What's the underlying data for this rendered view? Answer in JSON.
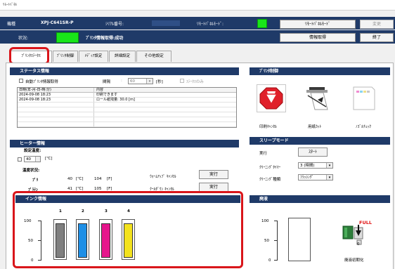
{
  "window": {
    "title": "ﾘﾓｰﾄﾊﾟﾈﾙ"
  },
  "header": {
    "model_label": "機種",
    "model_value": "XPJ-C641SR-P",
    "serial_label": "ｼﾘｱﾙ番号:",
    "serial_value": "",
    "remote_mode_label": "ﾘﾓｰﾄﾊﾟﾈﾙﾓｰﾄﾞ:",
    "remote_panel_mode_button": "ﾘﾓｰﾄﾊﾟﾈﾙﾓｰﾄﾞ",
    "change_button": "変更",
    "status_label": "状況:",
    "status_message": "ﾌﾟﾘﾝﾀ情報取得:成功",
    "info_get_button": "情報取得",
    "exit_button": "終了",
    "status_color": "#19e619"
  },
  "tabs": [
    {
      "label": "ﾌﾟﾘﾝﾀｽﾃｰﾀｽ",
      "active": true
    },
    {
      "label": "ﾌﾟﾘﾝﾀ制御",
      "active": false
    },
    {
      "label": "ﾒﾃﾞｨｱ設定",
      "active": false
    },
    {
      "label": "詳細設定",
      "active": false
    },
    {
      "label": "その他設定",
      "active": false
    }
  ],
  "status_section": {
    "title": "ステータス情報",
    "auto_get_label": "自動ﾌﾟﾘﾝﾀ情報取得",
    "interval_label": "間隔",
    "interval_value": "60",
    "interval_unit": "[秒]",
    "status_only_label": "ｽﾃｰﾀｽのみ",
    "history_headers": [
      "日時(年-月-日-時:分)",
      "内容"
    ],
    "history_rows": [
      {
        "datetime": "2024-09-08 18:23",
        "content": "印刷できます"
      },
      {
        "datetime": "2024-09-08 18:23",
        "content": "ロール紙残量: 30.0 [m]"
      }
    ]
  },
  "printer_control": {
    "title": "ﾌﾟﾘﾝﾀ制御",
    "items": [
      {
        "label": "印刷ｷｬﾝｾﾙ",
        "icon": "cancel-print-icon"
      },
      {
        "label": "用紙ｶｯﾄ",
        "icon": "paper-cut-icon"
      },
      {
        "label": "ﾉｽﾞﾙﾁｪｯｸ",
        "icon": "nozzle-check-icon"
      }
    ]
  },
  "heater": {
    "title": "ヒーター情報",
    "set_temp_label": "設定温度:",
    "set_temp_value": "40",
    "set_temp_unit": "[℃]",
    "temp_status_label": "温度状況:",
    "rows": [
      {
        "name": "ﾌﾟﾘ",
        "c": "40",
        "c_unit": "[℃]",
        "f": "104",
        "f_unit": "[F]"
      },
      {
        "name": "ﾌﾟﾗﾃﾝ",
        "c": "41",
        "c_unit": "[℃]",
        "f": "105",
        "f_unit": "[F]"
      }
    ],
    "warmup_cancel_label": "ｳｫｰﾑｱｯﾌﾟ ｷｬﾝｾﾙ",
    "cooldown_cancel_label": "ｸｰﾙﾀﾞｳﾝ ｷｬﾝｾﾙ",
    "execute_label": "実行"
  },
  "sleep_mode": {
    "title": "スリープモード",
    "execute_label": "実行",
    "start_button": "ｽﾀｰﾄ",
    "cleaning_timer_label": "ｸﾘｰﾆﾝｸﾞﾀｲﾏｰ",
    "cleaning_timer_value": "3 (時間)",
    "cleaning_type_label": "ｸﾘｰﾆﾝｸﾞ種類",
    "cleaning_type_value": "ﾌﾗｯｼﾝｸﾞ"
  },
  "ink": {
    "title": "インク情報",
    "ticks": [
      "100",
      "50",
      "0"
    ],
    "tanks": [
      {
        "number": "1",
        "color": "#7f7f7f",
        "level": 95
      },
      {
        "number": "2",
        "color": "#1e8fe6",
        "level": 95
      },
      {
        "number": "3",
        "color": "#e6158c",
        "level": 95
      },
      {
        "number": "4",
        "color": "#f3e21d",
        "level": 95
      }
    ]
  },
  "waste": {
    "title": "廃液",
    "ticks": [
      "100",
      "50",
      "0"
    ],
    "level": 0,
    "reset_label": "廃液初期化",
    "full_label": "FULL",
    "counter": "0"
  }
}
